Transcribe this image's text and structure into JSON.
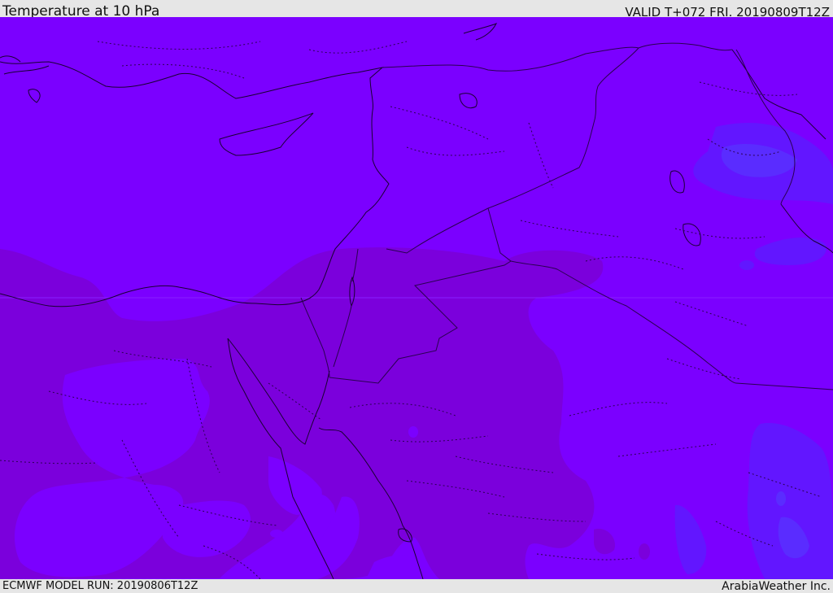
{
  "header": {
    "title": "Temperature at 10 hPa",
    "valid_time": "VALID T+072 FRI. 20190809T12Z"
  },
  "footer": {
    "model_run": "ECMWF MODEL RUN: 20190806T12Z",
    "credit": "ArabiaWeather Inc."
  },
  "colors": {
    "base_fill": "#7b00ff",
    "warm_band": "#7b00dc",
    "cold_pocket": "#6216ff",
    "cold_core": "#5a2cff",
    "coastline": "#1a0033",
    "border": "#2a0050"
  }
}
